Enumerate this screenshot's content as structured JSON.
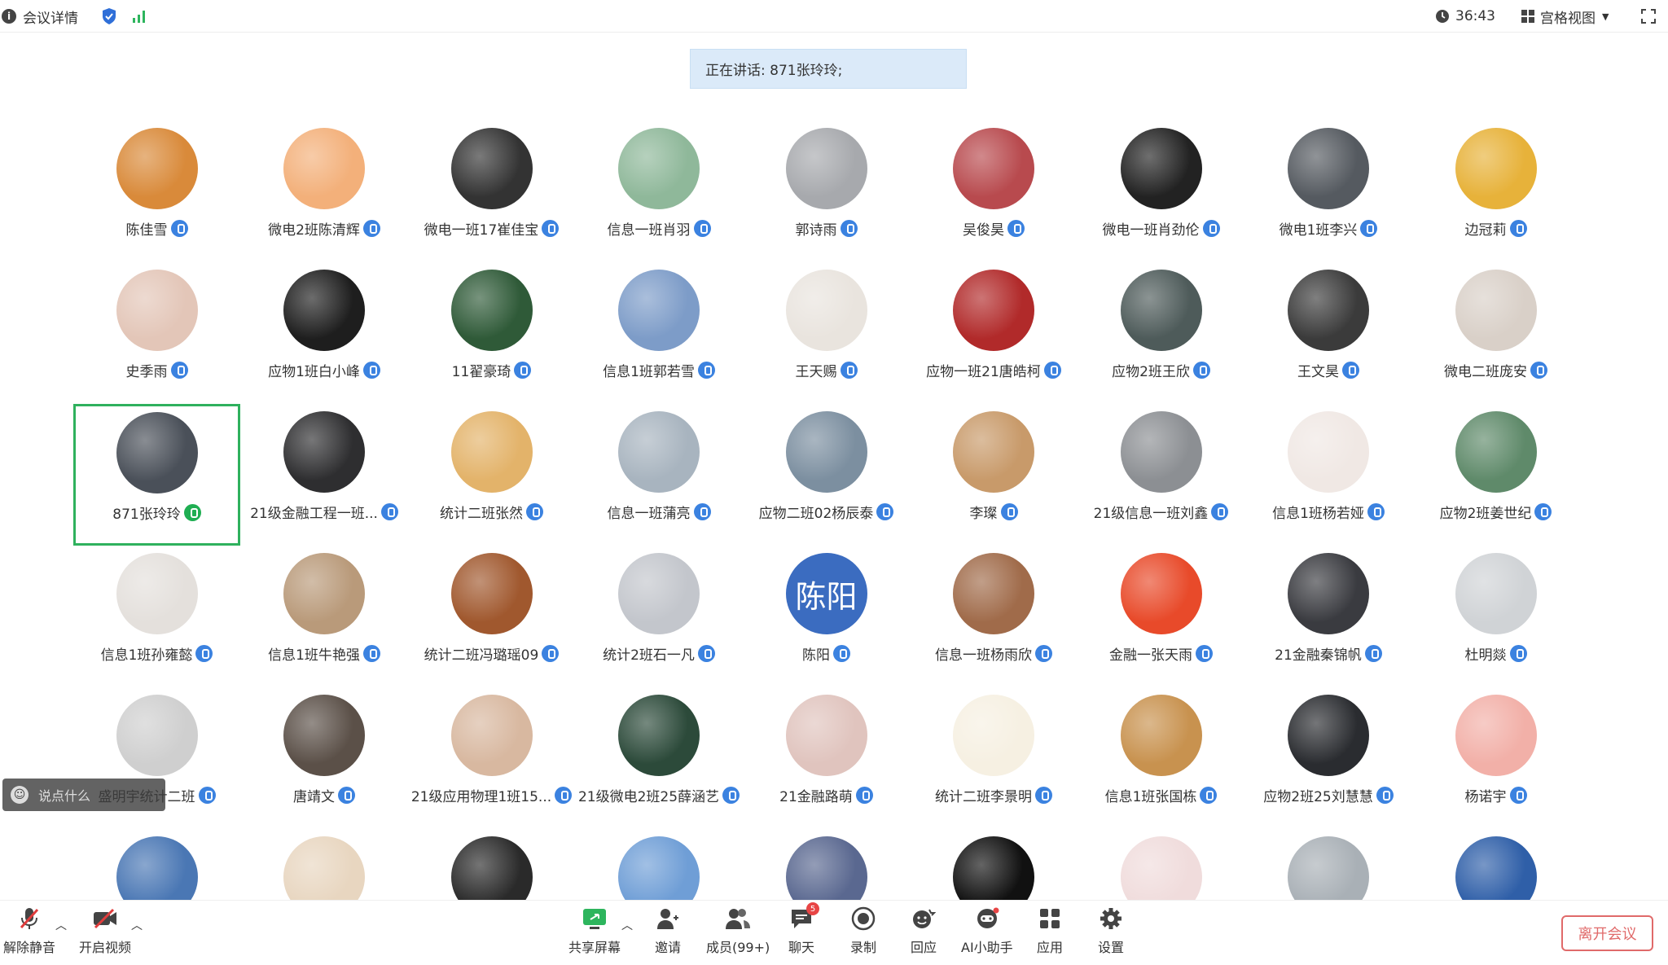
{
  "topbar": {
    "meeting_details": "会议详情",
    "timer": "36:43",
    "view_mode": "宫格视图"
  },
  "speaking": "正在讲话: 871张玲玲;",
  "colors": {
    "accent_blue": "#3b82e0",
    "speaking_green": "#1fae52",
    "active_border": "#2fb15d",
    "leave_red": "#e06a6a"
  },
  "participants": [
    {
      "name": "陈佳雪",
      "bg": "#d98a3a"
    },
    {
      "name": "微电2班陈清辉",
      "bg": "#f3b07a"
    },
    {
      "name": "微电一班17崔佳宝",
      "bg": "#333333"
    },
    {
      "name": "信息一班肖羽",
      "bg": "#8fb89a"
    },
    {
      "name": "郭诗雨",
      "bg": "#a7a9ad"
    },
    {
      "name": "吴俊昊",
      "bg": "#b84a4e"
    },
    {
      "name": "微电一班肖劲伦",
      "bg": "#222222"
    },
    {
      "name": "微电1班李兴",
      "bg": "#555a60"
    },
    {
      "name": "边冠莉",
      "bg": "#e7b23a"
    },
    {
      "name": "史季雨",
      "bg": "#e3c6b8"
    },
    {
      "name": "应物1班白小峰",
      "bg": "#1e1e1e"
    },
    {
      "name": "11翟豪琦",
      "bg": "#2f5a38"
    },
    {
      "name": "信息1班郭若雪",
      "bg": "#7d9cc8"
    },
    {
      "name": "王天赐",
      "bg": "#e9e4de"
    },
    {
      "name": "应物一班21唐皓柯",
      "bg": "#b12a2a"
    },
    {
      "name": "应物2班王欣",
      "bg": "#4e5b5a"
    },
    {
      "name": "王文昊",
      "bg": "#3b3b3b"
    },
    {
      "name": "微电二班庞安",
      "bg": "#d9d0c8"
    },
    {
      "name": "871张玲玲",
      "bg": "#4a5059",
      "active": true
    },
    {
      "name": "21级金融工程一班...",
      "bg": "#2e2e30"
    },
    {
      "name": "统计二班张然",
      "bg": "#e3b36a"
    },
    {
      "name": "信息一班蒲亮",
      "bg": "#a8b4bf"
    },
    {
      "name": "应物二班02杨辰泰",
      "bg": "#7c8fa0"
    },
    {
      "name": "李璨",
      "bg": "#c89a6a"
    },
    {
      "name": "21级信息一班刘鑫",
      "bg": "#8c8f93"
    },
    {
      "name": "信息1班杨若娅",
      "bg": "#f0e8e4"
    },
    {
      "name": "应物2班姜世纪",
      "bg": "#5f8a6a"
    },
    {
      "name": "信息1班孙雍懿",
      "bg": "#e4e0dc"
    },
    {
      "name": "信息1班牛艳强",
      "bg": "#b99a7a"
    },
    {
      "name": "统计二班冯璐瑶09",
      "bg": "#a0582e"
    },
    {
      "name": "统计2班石一凡",
      "bg": "#c3c6cc"
    },
    {
      "name": "陈阳",
      "bg": "#3b6cc0",
      "text": "陈阳"
    },
    {
      "name": "信息一班杨雨欣",
      "bg": "#a06b4a"
    },
    {
      "name": "金融一张天雨",
      "bg": "#e84a2a"
    },
    {
      "name": "21金融秦锦帆",
      "bg": "#3a3b40"
    },
    {
      "name": "杜明燚",
      "bg": "#d0d3d6"
    },
    {
      "name": "盛明宇统计二班",
      "bg": "#cfcfcf"
    },
    {
      "name": "唐靖文",
      "bg": "#5b5048"
    },
    {
      "name": "21级应用物理1班15...",
      "bg": "#d8b8a0"
    },
    {
      "name": "21级微电2班25薛涵艺",
      "bg": "#2c4a3a"
    },
    {
      "name": "21金融路萌",
      "bg": "#e0c4be"
    },
    {
      "name": "统计二班李景明",
      "bg": "#f6f0e2"
    },
    {
      "name": "信息1班张国栋",
      "bg": "#c8924f"
    },
    {
      "name": "应物2班25刘慧慧",
      "bg": "#2a2c30"
    },
    {
      "name": "杨诺宇",
      "bg": "#f2b0a8"
    },
    {
      "name": "",
      "bg": "#4a77b4"
    },
    {
      "name": "",
      "bg": "#e8d6c0"
    },
    {
      "name": "",
      "bg": "#2a2a2a"
    },
    {
      "name": "",
      "bg": "#6f9ed6"
    },
    {
      "name": "",
      "bg": "#5a6890"
    },
    {
      "name": "",
      "bg": "#111111"
    },
    {
      "name": "",
      "bg": "#f0dcdc"
    },
    {
      "name": "",
      "bg": "#a9b0b6"
    },
    {
      "name": "",
      "bg": "#2f5fa8"
    }
  ],
  "chat": {
    "placeholder": "说点什么"
  },
  "toolbar": {
    "unmute": "解除静音",
    "start_video": "开启视频",
    "share_screen": "共享屏幕",
    "invite": "邀请",
    "members": "成员(99+)",
    "chat": "聊天",
    "chat_badge": "5",
    "record": "录制",
    "react": "回应",
    "ai_assistant": "AI小助手",
    "apps": "应用",
    "settings": "设置",
    "leave": "离开会议"
  }
}
